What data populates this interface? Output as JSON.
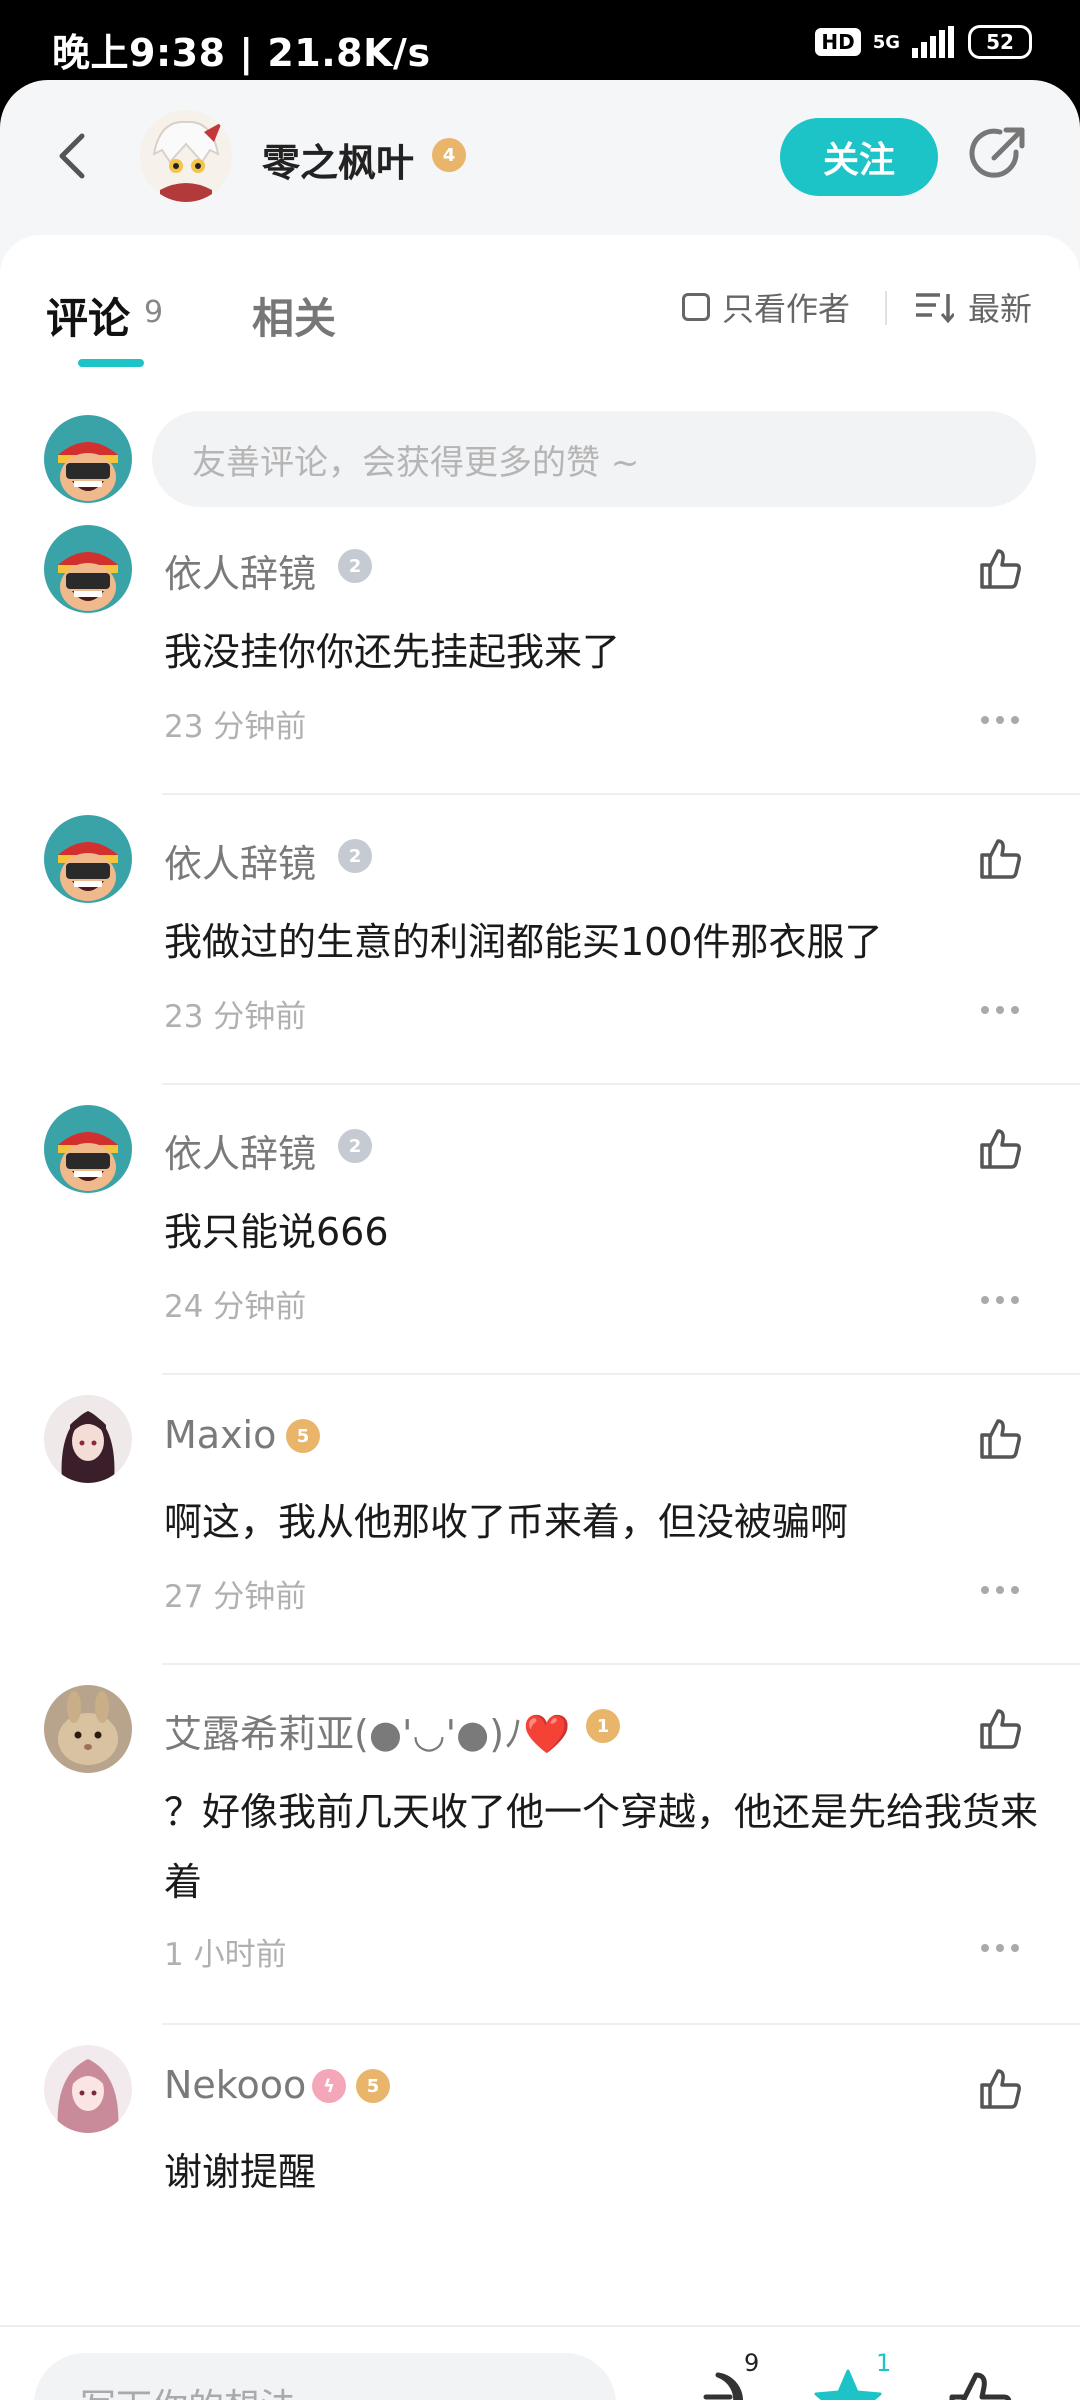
{
  "status_bar": {
    "time": "晚上9:38 | 21.8K/s",
    "hd": "HD",
    "network": "5G",
    "battery": "52"
  },
  "header": {
    "author_name": "零之枫叶",
    "author_level": "4",
    "follow_label": "关注"
  },
  "tabs": {
    "comments_label": "评论",
    "comments_count": "9",
    "related_label": "相关",
    "only_author_label": "只看作者",
    "sort_label": "最新"
  },
  "comment_input_placeholder": "友善评论，会获得更多的赞 ~",
  "comments": [
    {
      "name": "依人辞镜",
      "level": "2",
      "text": "我没挂你你还先挂起我来了",
      "time": "23 分钟前"
    },
    {
      "name": "依人辞镜",
      "level": "2",
      "text": "我做过的生意的利润都能买100件那衣服了",
      "time": "23 分钟前"
    },
    {
      "name": "依人辞镜",
      "level": "2",
      "text": "我只能说666",
      "time": "24 分钟前"
    },
    {
      "name": "Maxio",
      "level": "5",
      "text": "啊这，我从他那收了币来着，但没被骗啊",
      "time": "27 分钟前"
    },
    {
      "name": "艾露希莉亚(●'◡'●)ﾉ❤️",
      "level": "1",
      "text": "？好像我前几天收了他一个穿越，他还是先给我货来着",
      "time": "1 小时前"
    },
    {
      "name": "Nekooo",
      "level": "5",
      "text": "谢谢提醒",
      "time": ""
    }
  ],
  "bottom_bar": {
    "input_placeholder": "写下你的想法...",
    "comment_count": "9",
    "star_count": "1"
  },
  "colors": {
    "accent": "#1cc4c7",
    "gold_badge": "#e8b56a",
    "silver_badge": "#c5cad3"
  }
}
